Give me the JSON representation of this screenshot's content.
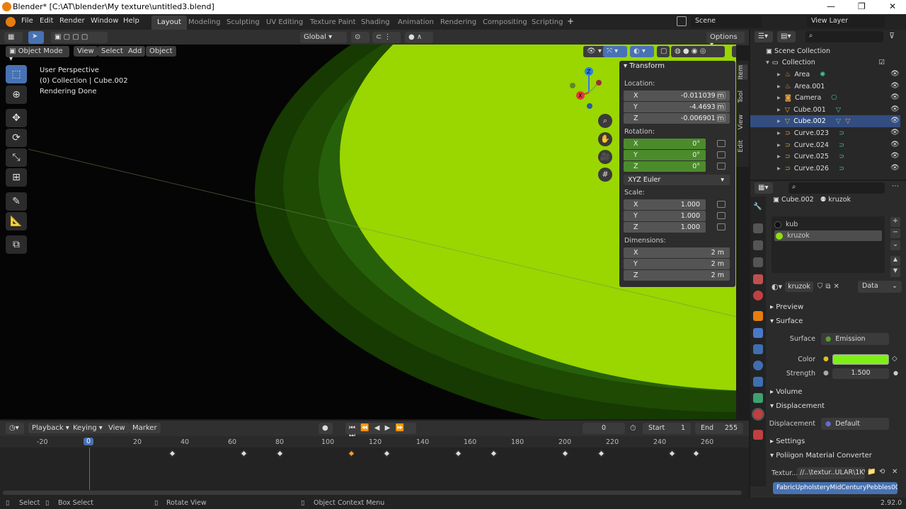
{
  "window": {
    "title": "Blender* [C:\\AT\\blender\\My texture\\untitled3.blend]",
    "minimize": "—",
    "maximize": "❐",
    "close": "✕"
  },
  "menu": [
    "File",
    "Edit",
    "Render",
    "Window",
    "Help"
  ],
  "workspaces": [
    "Layout",
    "Modeling",
    "Sculpting",
    "UV Editing",
    "Texture Paint",
    "Shading",
    "Animation",
    "Rendering",
    "Compositing",
    "Scripting"
  ],
  "add_workspace": "+",
  "scene": "Scene",
  "view_layer": "View Layer",
  "viewport": {
    "orientation": "Global",
    "options": "Options",
    "mode": "Object Mode",
    "menus": [
      "View",
      "Select",
      "Add",
      "Object"
    ],
    "overlay_lines": [
      "User Perspective",
      "(0) Collection | Cube.002",
      "Rendering Done"
    ],
    "gizmo_axes": {
      "z": "Z",
      "y": "Y",
      "x": "X"
    }
  },
  "npanel": {
    "header": "Transform",
    "location_label": "Location:",
    "location": [
      {
        "k": "X",
        "v": "-0.011039 m"
      },
      {
        "k": "Y",
        "v": "-4.4693 m"
      },
      {
        "k": "Z",
        "v": "-0.006901 m"
      }
    ],
    "rotation_label": "Rotation:",
    "rotation": [
      {
        "k": "X",
        "v": "0°"
      },
      {
        "k": "Y",
        "v": "0°"
      },
      {
        "k": "Z",
        "v": "0°"
      }
    ],
    "rotation_mode": "XYZ Euler",
    "scale_label": "Scale:",
    "scale": [
      {
        "k": "X",
        "v": "1.000"
      },
      {
        "k": "Y",
        "v": "1.000"
      },
      {
        "k": "Z",
        "v": "1.000"
      }
    ],
    "dimensions_label": "Dimensions:",
    "dimensions": [
      {
        "k": "X",
        "v": "2 m"
      },
      {
        "k": "Y",
        "v": "2 m"
      },
      {
        "k": "Z",
        "v": "2 m"
      }
    ],
    "tabs": [
      "Item",
      "Tool",
      "View",
      "Edit"
    ]
  },
  "timeline": {
    "menus": [
      "Playback",
      "Keying",
      "View",
      "Marker"
    ],
    "current_frame": "0",
    "start_label": "Start",
    "start": "1",
    "end_label": "End",
    "end": "255",
    "ruler": [
      "-20",
      "0",
      "20",
      "40",
      "60",
      "80",
      "100",
      "120",
      "140",
      "160",
      "180",
      "200",
      "220",
      "240",
      "260"
    ],
    "transport_icons": [
      "jump-start-icon",
      "prev-key-icon",
      "play-reverse-icon",
      "play-icon",
      "next-key-icon",
      "jump-end-icon"
    ]
  },
  "outliner": {
    "root": "Scene Collection",
    "items": [
      {
        "name": "Collection",
        "type": "collection"
      },
      {
        "name": "Area",
        "type": "light"
      },
      {
        "name": "Area.001",
        "type": "light"
      },
      {
        "name": "Camera",
        "type": "camera"
      },
      {
        "name": "Cube.001",
        "type": "mesh"
      },
      {
        "name": "Cube.002",
        "type": "mesh",
        "selected": true
      },
      {
        "name": "Curve.023",
        "type": "curve"
      },
      {
        "name": "Curve.024",
        "type": "curve"
      },
      {
        "name": "Curve.025",
        "type": "curve"
      },
      {
        "name": "Curve.026",
        "type": "curve"
      }
    ]
  },
  "properties": {
    "object": "Cube.002",
    "material": "kruzok",
    "slots": [
      {
        "name": "kub",
        "color": "#111111"
      },
      {
        "name": "kruzok",
        "color": "#8fdf0f"
      }
    ],
    "material_field": "kruzok",
    "link": "Data",
    "sections": {
      "preview": "Preview",
      "surface": "Surface",
      "volume": "Volume",
      "displacement": "Displacement",
      "settings": "Settings",
      "converter": "Poliigon Material Converter"
    },
    "surface_label": "Surface",
    "surface_value": "Emission",
    "color_label": "Color",
    "color_value": "#7ef018",
    "strength_label": "Strength",
    "strength_value": "1.500",
    "displacement_label": "Displacement",
    "displacement_value": "Default",
    "texture_label": "Textur...",
    "texture_path": "//..\\textur..ULAR\\1K\\",
    "texture_button": "FabricUpholsteryMidCenturyPebbles00"
  },
  "status": {
    "select": "Select",
    "box_select": "Box Select",
    "rotate": "Rotate View",
    "context": "Object Context Menu",
    "version": "2.92.0"
  },
  "colors": {
    "accent": "#4772b3",
    "green_object": "#9ad600",
    "selected_row": "#334d80"
  }
}
